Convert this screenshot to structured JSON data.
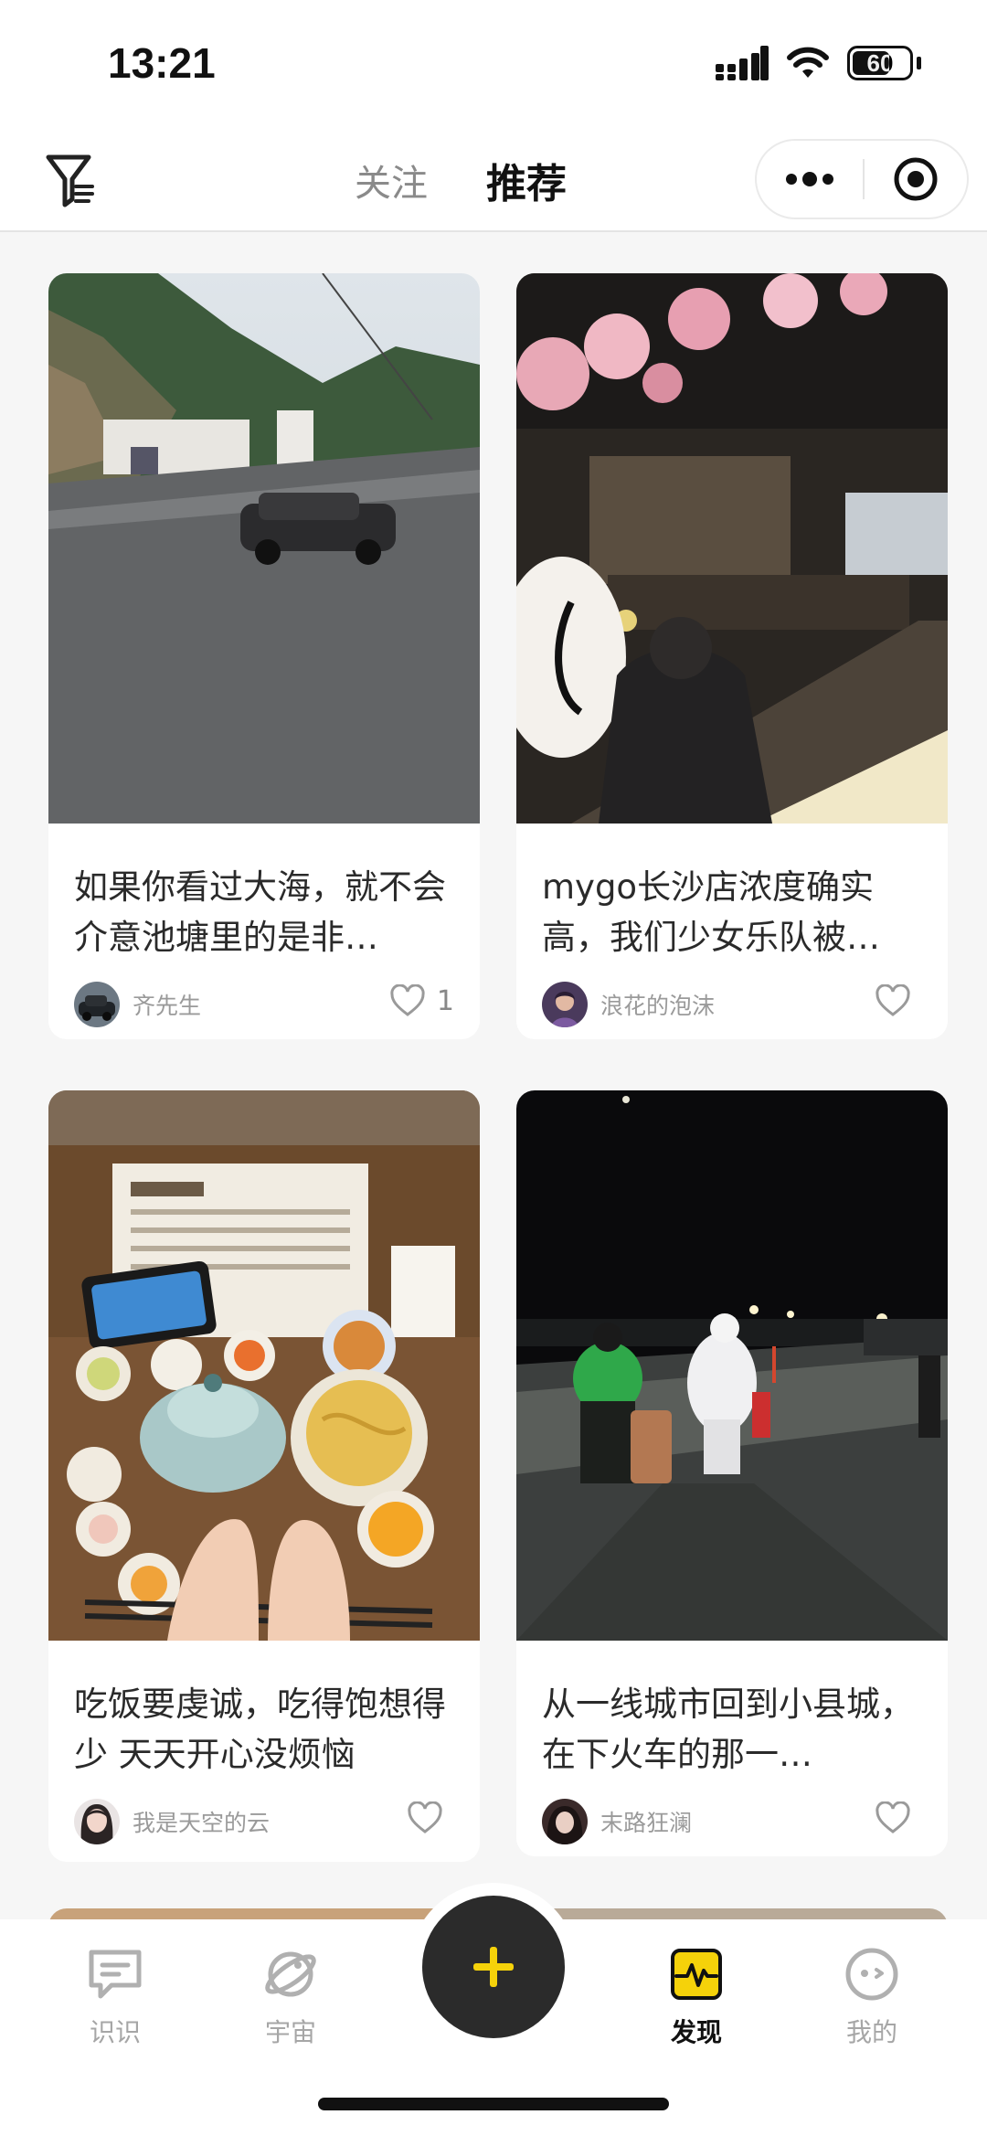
{
  "status_bar": {
    "time": "13:21",
    "battery": "60",
    "icons": [
      "signal-icon",
      "wifi-icon",
      "battery-icon"
    ]
  },
  "header": {
    "filter_icon": "filter-icon",
    "tabs": [
      {
        "label": "关注",
        "active": false
      },
      {
        "label": "推荐",
        "active": true
      }
    ],
    "capsule": {
      "more_icon": "more-dots-icon",
      "close_icon": "target-circle-icon"
    }
  },
  "feed": {
    "cards": [
      {
        "title": "如果你看过大海，就不会介意池塘里的是非…",
        "author": "齐先生",
        "likes": "1",
        "image": "photo-road-villa-car"
      },
      {
        "title": "mygo长沙店浓度确实高，我们少女乐队被…",
        "author": "浪花的泡沫",
        "likes": "",
        "image": "photo-cafe-cherry-blossom"
      },
      {
        "title": "吃饭要虔诚，吃得饱想得少 天天开心没烦恼",
        "author": "我是天空的云",
        "likes": "",
        "image": "photo-noodle-meal-tray"
      },
      {
        "title": "从一线城市回到小县城，在下火车的那一…",
        "author": "末路狂澜",
        "likes": "",
        "image": "photo-night-station-travelers"
      }
    ]
  },
  "tabbar": {
    "items": [
      {
        "label": "识识",
        "icon": "chat-bubble-icon",
        "active": false
      },
      {
        "label": "宇宙",
        "icon": "planet-icon",
        "active": false
      },
      {
        "label": "发现",
        "icon": "pulse-icon",
        "active": true
      },
      {
        "label": "我的",
        "icon": "face-icon",
        "active": false
      }
    ],
    "fab_icon": "plus-icon",
    "accent_color": "#f5d20a"
  }
}
